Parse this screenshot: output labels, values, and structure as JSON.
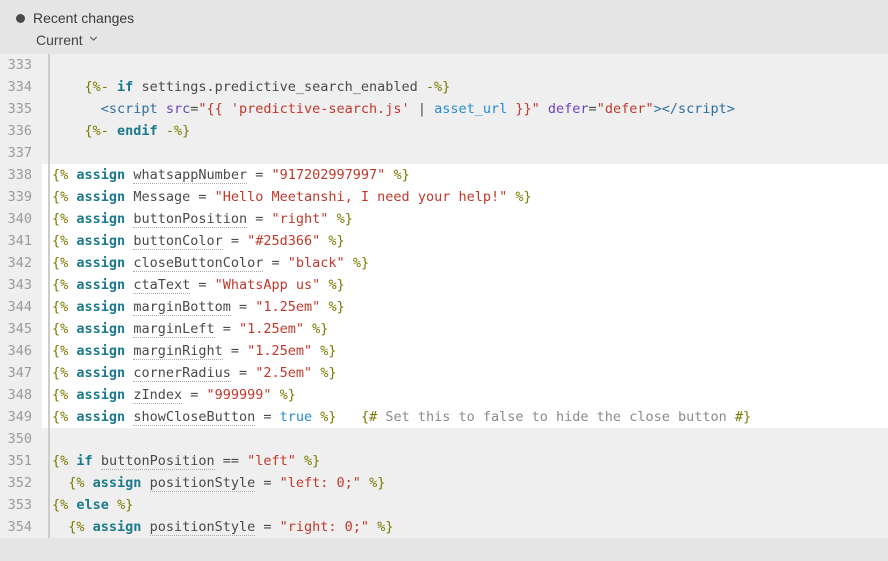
{
  "header": {
    "title": "Recent changes",
    "dropdown_label": "Current"
  },
  "editor": {
    "first_line_number": 333,
    "highlight_start": 338,
    "highlight_end": 349,
    "values": {
      "whatsappNumber": "917202997997",
      "Message": "Hello Meetanshi, I need your help!",
      "buttonPosition": "right",
      "buttonColor": "#25d366",
      "closeButtonColor": "black",
      "ctaText": "WhatsApp us",
      "marginBottom": "1.25em",
      "marginLeft": "1.25em",
      "marginRight": "1.25em",
      "cornerRadius": "2.5em",
      "zIndex": "999999",
      "showCloseButton": "true"
    },
    "comment_349": "Set this to false to hide the close button",
    "lines": [
      {
        "n": 333,
        "html": ""
      },
      {
        "n": 334,
        "html": "    <span class='br'>{%-</span> <span class='kw'>if</span> settings.predictive_search_enabled <span class='br'>-%}</span>"
      },
      {
        "n": 335,
        "html": "      <span class='tag'>&lt;script</span> <span class='attr'>src</span>=<span class='str'>\"{{ 'predictive-search.js'</span> | <span class='fn'>asset_url</span> <span class='str'>}}\"</span> <span class='attr'>defer</span>=<span class='str'>\"defer\"</span><span class='tag'>&gt;&lt;/script&gt;</span>"
      },
      {
        "n": 336,
        "html": "    <span class='br'>{%-</span> <span class='kw'>endif</span> <span class='br'>-%}</span>"
      },
      {
        "n": 337,
        "html": ""
      },
      {
        "n": 338,
        "html": "<span class='br'>{%</span> <span class='kw'>assign</span> <span class='var underline'>whatsappNumber</span> = <span class='str'>\"917202997997\"</span> <span class='br'>%}</span>"
      },
      {
        "n": 339,
        "html": "<span class='br'>{%</span> <span class='kw'>assign</span> <span class='var'>Message</span> = <span class='str'>\"Hello Meetanshi, I need your help!\"</span> <span class='br'>%}</span>"
      },
      {
        "n": 340,
        "html": "<span class='br'>{%</span> <span class='kw'>assign</span> <span class='var underline'>buttonPosition</span> = <span class='str'>\"right\"</span> <span class='br'>%}</span>"
      },
      {
        "n": 341,
        "html": "<span class='br'>{%</span> <span class='kw'>assign</span> <span class='var underline'>buttonColor</span> = <span class='str'>\"#25d366\"</span> <span class='br'>%}</span>"
      },
      {
        "n": 342,
        "html": "<span class='br'>{%</span> <span class='kw'>assign</span> <span class='var underline'>closeButtonColor</span> = <span class='str'>\"black\"</span> <span class='br'>%}</span>"
      },
      {
        "n": 343,
        "html": "<span class='br'>{%</span> <span class='kw'>assign</span> <span class='var underline'>ctaText</span> = <span class='str'>\"WhatsApp us\"</span> <span class='br'>%}</span>"
      },
      {
        "n": 344,
        "html": "<span class='br'>{%</span> <span class='kw'>assign</span> <span class='var underline'>marginBottom</span> = <span class='str'>\"1.25em\"</span> <span class='br'>%}</span>"
      },
      {
        "n": 345,
        "html": "<span class='br'>{%</span> <span class='kw'>assign</span> <span class='var underline'>marginLeft</span> = <span class='str'>\"1.25em\"</span> <span class='br'>%}</span>"
      },
      {
        "n": 346,
        "html": "<span class='br'>{%</span> <span class='kw'>assign</span> <span class='var underline'>marginRight</span> = <span class='str'>\"1.25em\"</span> <span class='br'>%}</span>"
      },
      {
        "n": 347,
        "html": "<span class='br'>{%</span> <span class='kw'>assign</span> <span class='var underline'>cornerRadius</span> = <span class='str'>\"2.5em\"</span> <span class='br'>%}</span>"
      },
      {
        "n": 348,
        "html": "<span class='br'>{%</span> <span class='kw'>assign</span> <span class='var underline'>zIndex</span> = <span class='str'>\"999999\"</span> <span class='br'>%}</span>"
      },
      {
        "n": 349,
        "html": "<span class='br'>{%</span> <span class='kw'>assign</span> <span class='var underline'>showCloseButton</span> = <span class='true'>true</span> <span class='br'>%}</span>   <span class='br'>{#</span> <span class='cmt'>Set this to false to hide the close button</span> <span class='br'>#}</span>"
      },
      {
        "n": 350,
        "html": ""
      },
      {
        "n": 351,
        "html": "<span class='br'>{%</span> <span class='kw'>if</span> <span class='var underline'>buttonPosition</span> == <span class='str'>\"left\"</span> <span class='br'>%}</span>"
      },
      {
        "n": 352,
        "html": "  <span class='br'>{%</span> <span class='kw'>assign</span> <span class='var underline'>positionStyle</span> = <span class='str'>\"left: 0;\"</span> <span class='br'>%}</span>"
      },
      {
        "n": 353,
        "html": "<span class='br'>{%</span> <span class='kw'>else</span> <span class='br'>%}</span>"
      },
      {
        "n": 354,
        "html": "  <span class='br'>{%</span> <span class='kw'>assign</span> <span class='var underline'>positionStyle</span> = <span class='str'>\"right: 0;\"</span> <span class='br'>%}</span>"
      }
    ]
  }
}
